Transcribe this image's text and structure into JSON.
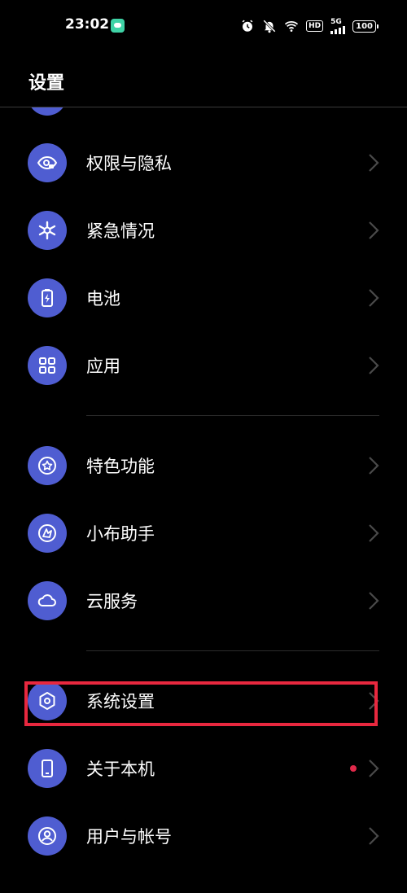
{
  "status_bar": {
    "time": "23:02",
    "hd": "HD",
    "network": "5G",
    "battery": "100"
  },
  "header": {
    "title": "设置"
  },
  "sections": [
    {
      "items": [
        {
          "label": "权限与隐私",
          "icon": "eye-lock-icon"
        },
        {
          "label": "紧急情况",
          "icon": "asterisk-icon"
        },
        {
          "label": "电池",
          "icon": "battery-icon"
        },
        {
          "label": "应用",
          "icon": "apps-grid-icon"
        }
      ]
    },
    {
      "items": [
        {
          "label": "特色功能",
          "icon": "star-circle-icon"
        },
        {
          "label": "小布助手",
          "icon": "assistant-icon"
        },
        {
          "label": "云服务",
          "icon": "cloud-icon"
        }
      ]
    },
    {
      "items": [
        {
          "label": "系统设置",
          "icon": "hexagon-gear-icon",
          "highlighted": true
        },
        {
          "label": "关于本机",
          "icon": "phone-icon",
          "badge": "red-dot"
        },
        {
          "label": "用户与帐号",
          "icon": "user-circle-icon"
        }
      ]
    }
  ],
  "colors": {
    "background": "#000000",
    "icon_background": "#4f5dd1",
    "chevron": "#4a4a4a",
    "divider": "#2c2c2c",
    "highlight": "#e8283f",
    "badge": "#e0294a"
  }
}
